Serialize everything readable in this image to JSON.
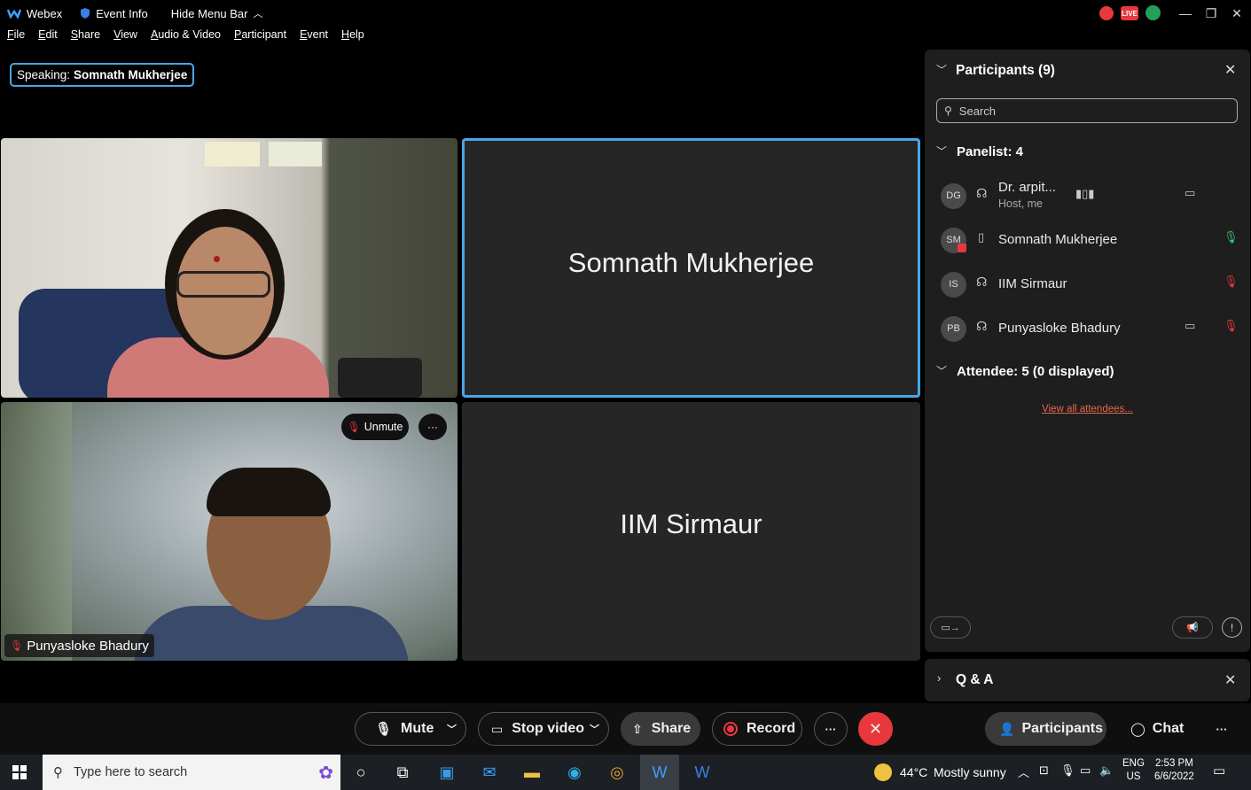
{
  "titlebar": {
    "app_name": "Webex",
    "event_info": "Event Info",
    "hide_menu": "Hide Menu Bar",
    "live_badge": "LIVE"
  },
  "menu": [
    "File",
    "Edit",
    "Share",
    "View",
    "Audio & Video",
    "Participant",
    "Event",
    "Help"
  ],
  "speaking": {
    "label": "Speaking:",
    "name": "Somnath Mukherjee"
  },
  "tiles": {
    "somnath": "Somnath Mukherjee",
    "iim": "IIM Sirmaur",
    "punyasloke_label": "Punyasloke Bhadury",
    "unmute": "Unmute",
    "more": "···"
  },
  "panel": {
    "title": "Participants (9)",
    "search_placeholder": "Search",
    "panelist_header": "Panelist: 4",
    "attendee_header": "Attendee: 5 (0 displayed)",
    "view_all": "View all attendees...",
    "participants": [
      {
        "initials": "DG",
        "name": "Dr. arpit...",
        "sub": "Host, me"
      },
      {
        "initials": "SM",
        "name": "Somnath Mukherjee",
        "sub": ""
      },
      {
        "initials": "IS",
        "name": "IIM Sirmaur",
        "sub": ""
      },
      {
        "initials": "PB",
        "name": "Punyasloke Bhadury",
        "sub": ""
      }
    ]
  },
  "qa": {
    "title": "Q & A"
  },
  "controls": {
    "mute": "Mute",
    "stop_video": "Stop video",
    "share": "Share",
    "record": "Record",
    "more": "···",
    "participants": "Participants",
    "chat": "Chat",
    "overflow": "···"
  },
  "taskbar": {
    "search_placeholder": "Type here to search",
    "weather_temp": "44°C",
    "weather_text": "Mostly sunny",
    "lang1": "ENG",
    "lang2": "US",
    "time": "2:53 PM",
    "date": "6/6/2022"
  },
  "colors": {
    "accent_blue": "#4aa6e8",
    "record_red": "#e8383d",
    "link_orange": "#e8674a",
    "mic_green": "#3cc46a"
  }
}
